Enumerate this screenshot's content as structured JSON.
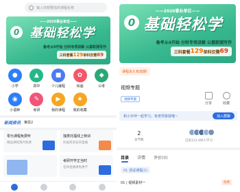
{
  "left": {
    "search": {
      "placeholder": "输入你想要找的课程名称"
    },
    "banner": {
      "year": "——2020事业单位——",
      "zero": "0",
      "headline": "基础轻松学",
      "subtitle": "备考从0开始 分科专项讲解 公基职测写作",
      "price_prefix": "三科套餐",
      "price_main": "129",
      "price_mid": "单科仅需",
      "price_single": "69"
    },
    "categories": [
      {
        "label": "小学",
        "icon": "book-icon",
        "color": "#2d7ff9"
      },
      {
        "label": "高中",
        "icon": "graduation-icon",
        "color": "#25b889"
      },
      {
        "label": "少儿编程",
        "icon": "code-icon",
        "color": "#4c7cf0"
      },
      {
        "label": "绘画",
        "icon": "palette-icon",
        "color": "#f5566c"
      },
      {
        "label": "公考",
        "icon": "briefcase-icon",
        "color": "#2aa876"
      },
      {
        "label": "小语种",
        "icon": "globe-icon",
        "color": "#2d7ff9"
      },
      {
        "label": "考研",
        "icon": "pen-icon",
        "color": "#f0567a"
      },
      {
        "label": "我的课程",
        "icon": "play-icon",
        "color": "#f5a623"
      },
      {
        "label": "我的收藏",
        "icon": "star-icon",
        "color": "#f5a623"
      }
    ],
    "news": {
      "tag": "新闻资讯",
      "title": "莱恩2"
    },
    "cards": [
      {
        "title": "零元课程免费听",
        "subtitle": "精品课程限时免费"
      },
      {
        "title": "独类托福线上特训",
        "subtitle": "托福英语名师直播"
      },
      {
        "title": "考研开学正当时",
        "subtitle": "名师直播课免费学"
      },
      {
        "title": "",
        "subtitle": ""
      }
    ]
  },
  "right": {
    "banner": {
      "year": "——2020事业单位——",
      "zero": "0",
      "headline": "基础轻松学",
      "subtitle": "备考从0开始 分科专项讲解 公基职测写作",
      "price_prefix": "三科套餐",
      "price_main": "129",
      "price_mid": "单科仅需",
      "price_single": "69"
    },
    "notice": "课程永久有效期!",
    "video_title": "视频专题",
    "video_tag": "视频专题",
    "actions": [
      {
        "label": "分享",
        "icon": "share-icon"
      },
      {
        "label": "收藏",
        "icon": "favorite-icon"
      }
    ],
    "group": {
      "text": "和小伙伴一起学习，有老师答疑哦~",
      "button": "加入群聊"
    },
    "stats": [
      {
        "value": "2",
        "label": "总节数"
      },
      {
        "value": "",
        "label": "已有123.4W人学习"
      }
    ],
    "tabs": [
      "目录",
      "详情",
      "评价(0)"
    ],
    "chapter": "01 测试课程(1)",
    "lesson": {
      "title": "01 | 视频素材一",
      "badge": "免费"
    }
  },
  "colors": {
    "accent": "#2d6cdf",
    "banner_green": "#37b88e",
    "notice_orange": "#e8622c"
  }
}
